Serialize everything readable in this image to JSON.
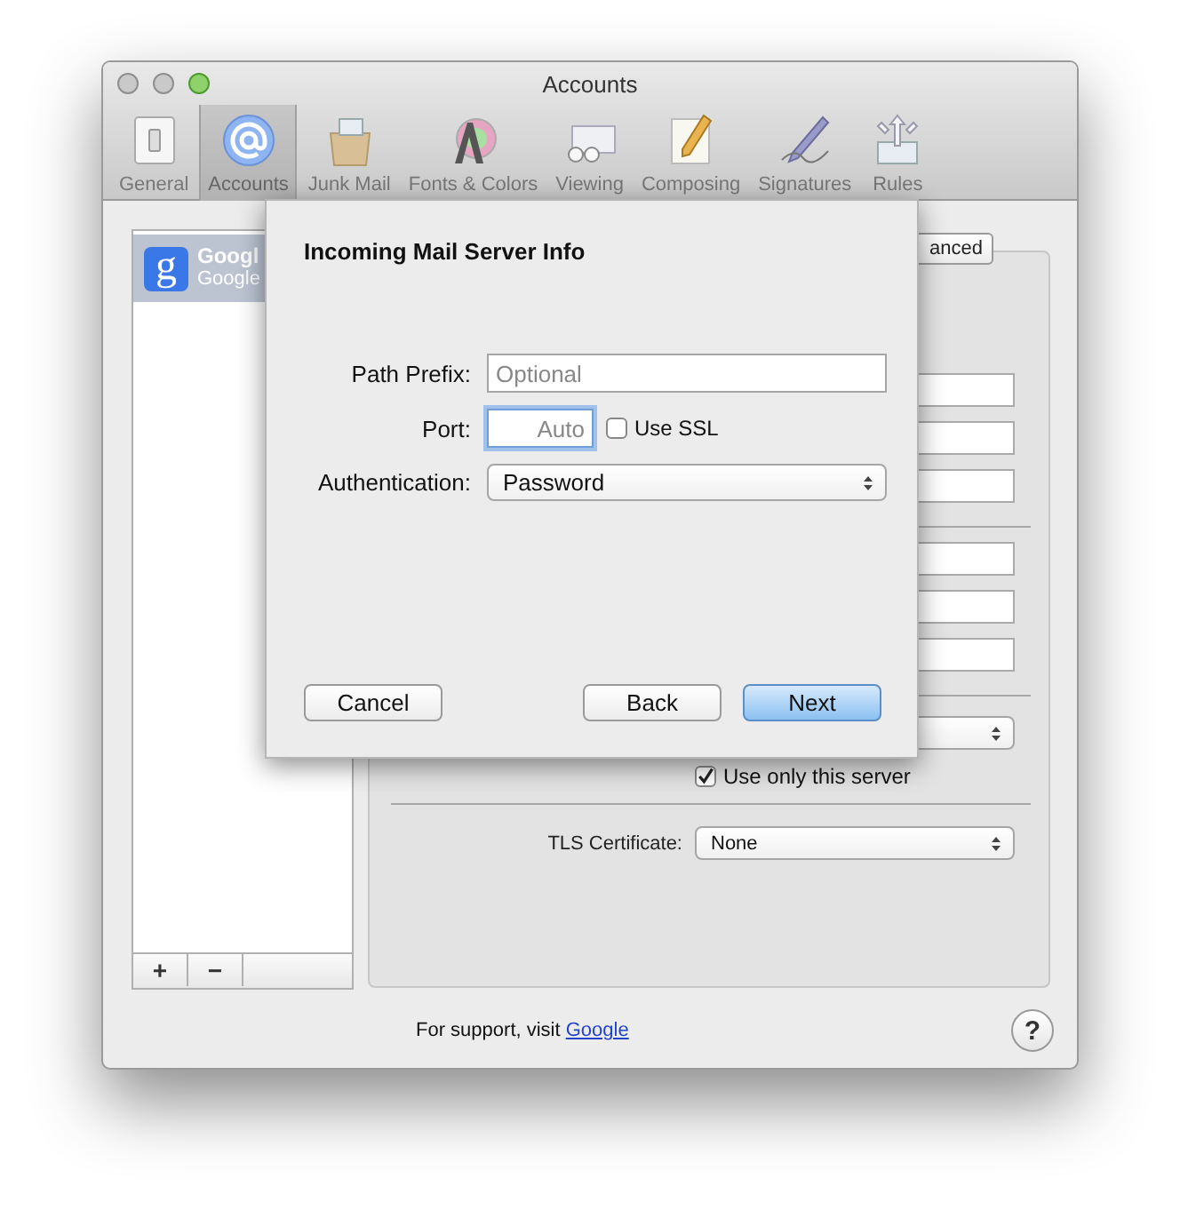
{
  "window": {
    "title": "Accounts"
  },
  "toolbar": {
    "items": [
      {
        "label": "General",
        "selected": false
      },
      {
        "label": "Accounts",
        "selected": true
      },
      {
        "label": "Junk Mail",
        "selected": false
      },
      {
        "label": "Fonts & Colors",
        "selected": false
      },
      {
        "label": "Viewing",
        "selected": false
      },
      {
        "label": "Composing",
        "selected": false
      },
      {
        "label": "Signatures",
        "selected": false
      },
      {
        "label": "Rules",
        "selected": false
      }
    ]
  },
  "sidebar": {
    "accounts": [
      {
        "logo_letter": "g",
        "name": "Googl",
        "subtitle": "Google",
        "selected": true
      }
    ],
    "add_button": "+",
    "remove_button": "−"
  },
  "panel": {
    "tab": {
      "label": "anced"
    },
    "use_only_this_server": {
      "label": "Use only this server",
      "checked": true
    },
    "tls_certificate": {
      "label": "TLS Certificate:",
      "value": "None"
    }
  },
  "footer": {
    "text": "For support, visit",
    "link": "Google",
    "help": "?"
  },
  "sheet": {
    "title": "Incoming Mail Server Info",
    "path_prefix": {
      "label": "Path Prefix:",
      "placeholder": "Optional"
    },
    "port": {
      "label": "Port:",
      "placeholder": "Auto",
      "focused": true
    },
    "use_ssl": {
      "label": "Use SSL",
      "checked": false
    },
    "authentication": {
      "label": "Authentication:",
      "value": "Password"
    },
    "buttons": [
      {
        "label": "Cancel",
        "kind": "cancel"
      },
      {
        "label": "Back",
        "kind": "secondary"
      },
      {
        "label": "Next",
        "kind": "default"
      }
    ]
  }
}
